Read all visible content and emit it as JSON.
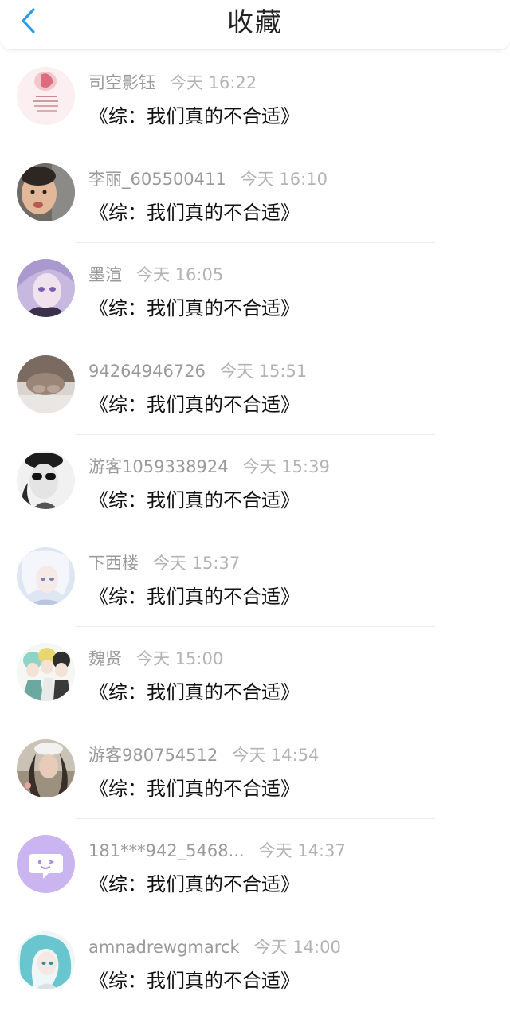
{
  "header": {
    "title": "收藏",
    "back_icon": "chevron-left-icon",
    "accent_color": "#2f9ae8"
  },
  "favorites": [
    {
      "user": "司空影钰",
      "time": "今天 16:22",
      "title": "《综：我们真的不合适》",
      "avatar": "avatar-pink-artwork"
    },
    {
      "user": "李丽_605500411",
      "time": "今天 16:10",
      "title": "《综：我们真的不合适》",
      "avatar": "avatar-child-photo"
    },
    {
      "user": "墨渲",
      "time": "今天 16:05",
      "title": "《综：我们真的不合适》",
      "avatar": "avatar-anime-purple"
    },
    {
      "user": "94264946726",
      "time": "今天 15:51",
      "title": "《综：我们真的不合适》",
      "avatar": "avatar-cat-photo"
    },
    {
      "user": "游客1059338924",
      "time": "今天 15:39",
      "title": "《综：我们真的不合适》",
      "avatar": "avatar-sunglasses-sketch"
    },
    {
      "user": "下西楼",
      "time": "今天 15:37",
      "title": "《综：我们真的不合适》",
      "avatar": "avatar-anime-white-hair"
    },
    {
      "user": "魏贤",
      "time": "今天 15:00",
      "title": "《综：我们真的不合适》",
      "avatar": "avatar-anime-group"
    },
    {
      "user": "游客980754512",
      "time": "今天 14:54",
      "title": "《综：我们真的不合适》",
      "avatar": "avatar-girl-cap"
    },
    {
      "user": "181***942_5468...",
      "time": "今天 14:37",
      "title": "《综：我们真的不合适》",
      "avatar": "avatar-default-chat"
    },
    {
      "user": "amnadrewgmarck",
      "time": "今天 14:00",
      "title": "《综：我们真的不合适》",
      "avatar": "avatar-anime-cyan"
    }
  ]
}
